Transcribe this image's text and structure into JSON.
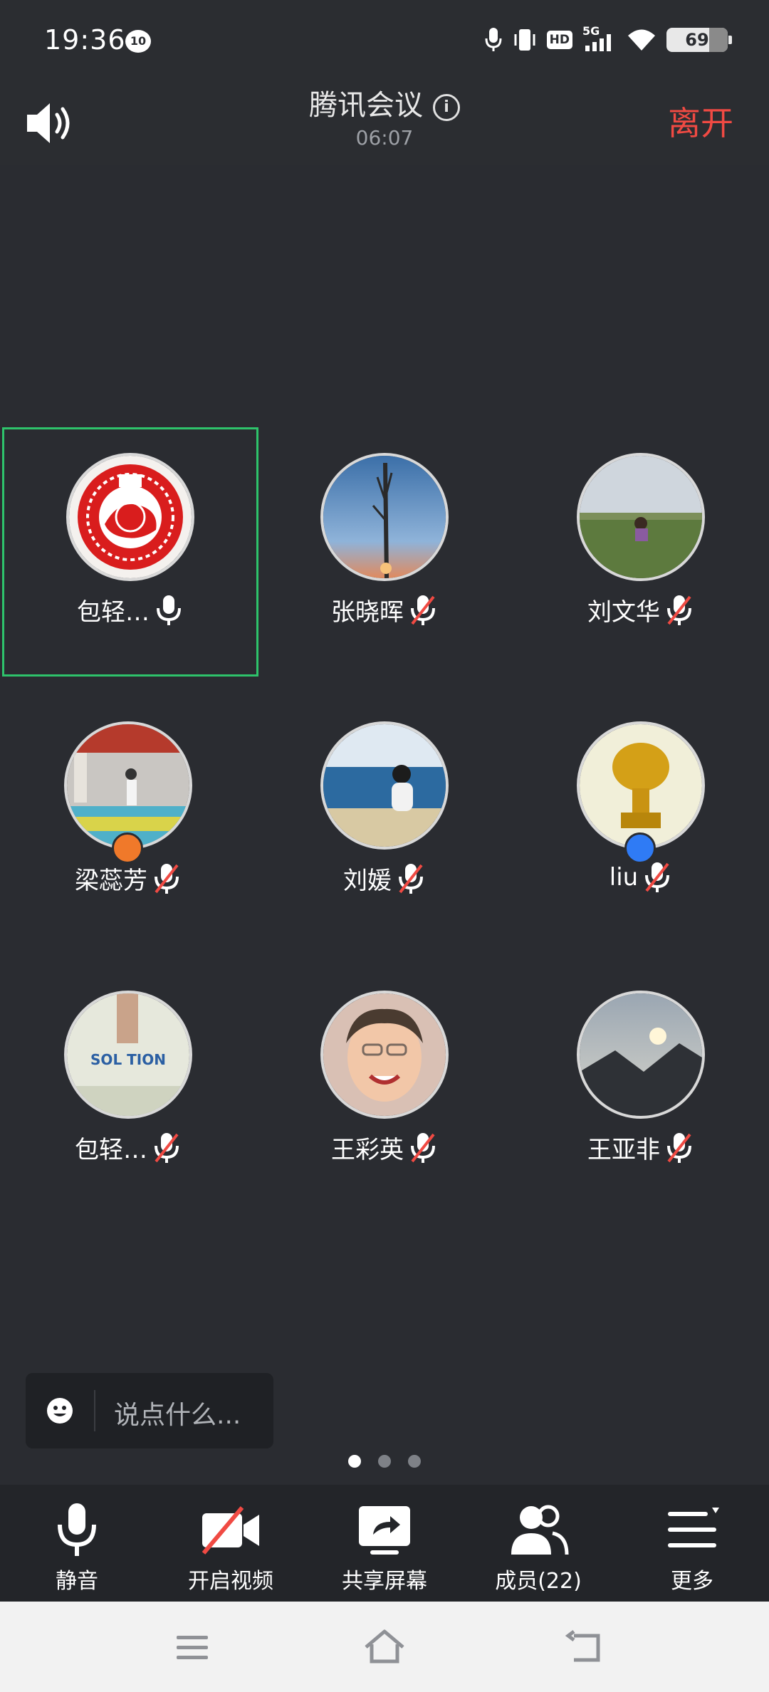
{
  "status_bar": {
    "time": "19:36",
    "notification_badge": "10",
    "network": "5G",
    "hd": "HD",
    "battery": "69"
  },
  "header": {
    "title": "腾讯会议",
    "timer": "06:07",
    "leave_label": "离开"
  },
  "participants": [
    {
      "name": "包轻…",
      "mic": "on",
      "active": true
    },
    {
      "name": "张晓晖",
      "mic": "muted"
    },
    {
      "name": "刘文华",
      "mic": "muted"
    },
    {
      "name": "梁蕊芳",
      "mic": "muted",
      "badge": "orange"
    },
    {
      "name": "刘媛",
      "mic": "muted"
    },
    {
      "name": "liu",
      "mic": "muted",
      "badge": "blue"
    },
    {
      "name": "包轻…",
      "mic": "muted"
    },
    {
      "name": "王彩英",
      "mic": "muted"
    },
    {
      "name": "王亚非",
      "mic": "muted"
    }
  ],
  "avatar_text": {
    "solution": "SOL TION"
  },
  "chat": {
    "placeholder": "说点什么..."
  },
  "pagination": {
    "pages": 3,
    "current": 1
  },
  "toolbar": {
    "mute_label": "静音",
    "video_label": "开启视频",
    "share_label": "共享屏幕",
    "members_label": "成员(22)",
    "more_label": "更多"
  },
  "colors": {
    "accent_leave": "#f04a43",
    "active_outline": "#2ec36b",
    "muted_red": "#f04a43",
    "badge_orange": "#f0792a",
    "badge_blue": "#2f7bf5"
  }
}
